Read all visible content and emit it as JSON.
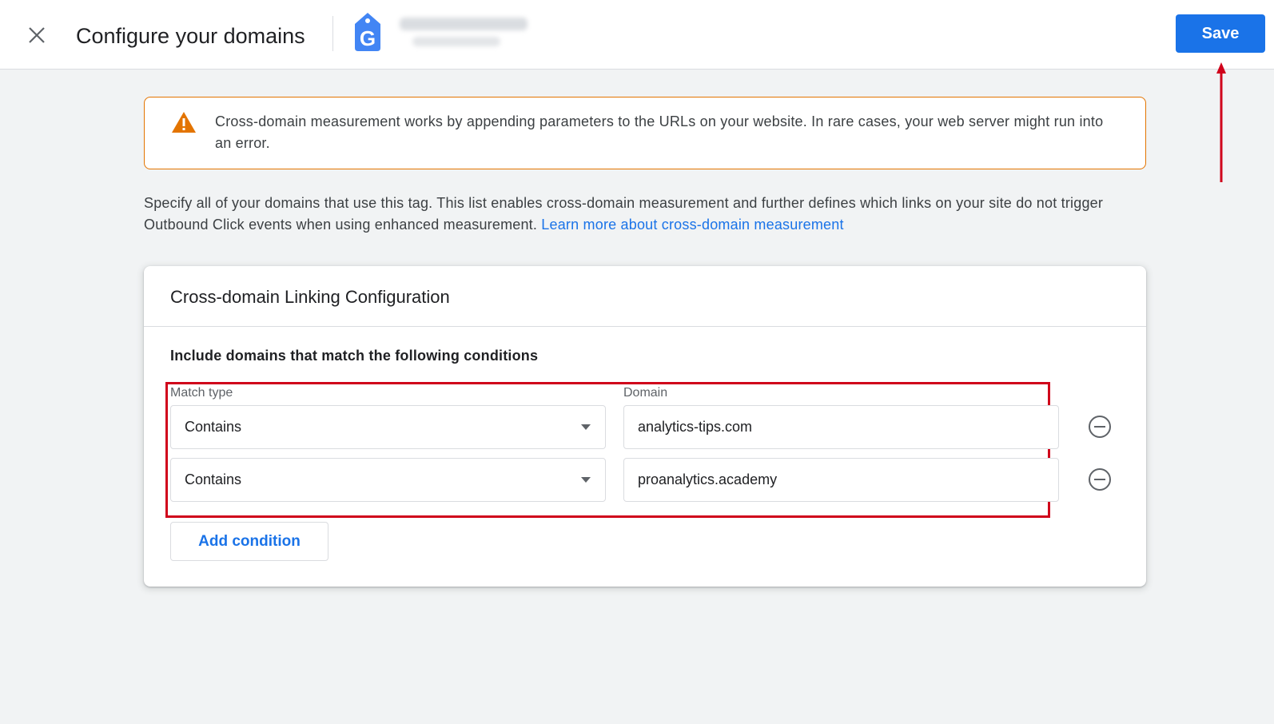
{
  "header": {
    "title": "Configure your domains",
    "save_label": "Save",
    "tag_icon_letter": "G"
  },
  "warning": {
    "text": "Cross-domain measurement works by appending parameters to the URLs on your website. In rare cases, your web server might run into an error."
  },
  "description": {
    "text": "Specify all of your domains that use this tag. This list enables cross-domain measurement and further defines which links on your site do not trigger Outbound Click events when using enhanced measurement. ",
    "link_label": "Learn more about cross-domain measurement"
  },
  "card": {
    "title": "Cross-domain Linking Configuration",
    "conditions_heading": "Include domains that match the following conditions",
    "match_type_label": "Match type",
    "domain_label": "Domain",
    "rows": [
      {
        "match_type": "Contains",
        "domain": "analytics-tips.com"
      },
      {
        "match_type": "Contains",
        "domain": "proanalytics.academy"
      }
    ],
    "add_condition_label": "Add condition"
  },
  "icons": {
    "close": "close-icon",
    "tag": "google-tag-icon",
    "warning": "warning-triangle-icon",
    "remove": "remove-circle-icon",
    "dropdown": "chevron-down-icon"
  },
  "colors": {
    "primary": "#1a73e8",
    "warning": "#e37400",
    "annotation": "#d0021b"
  }
}
